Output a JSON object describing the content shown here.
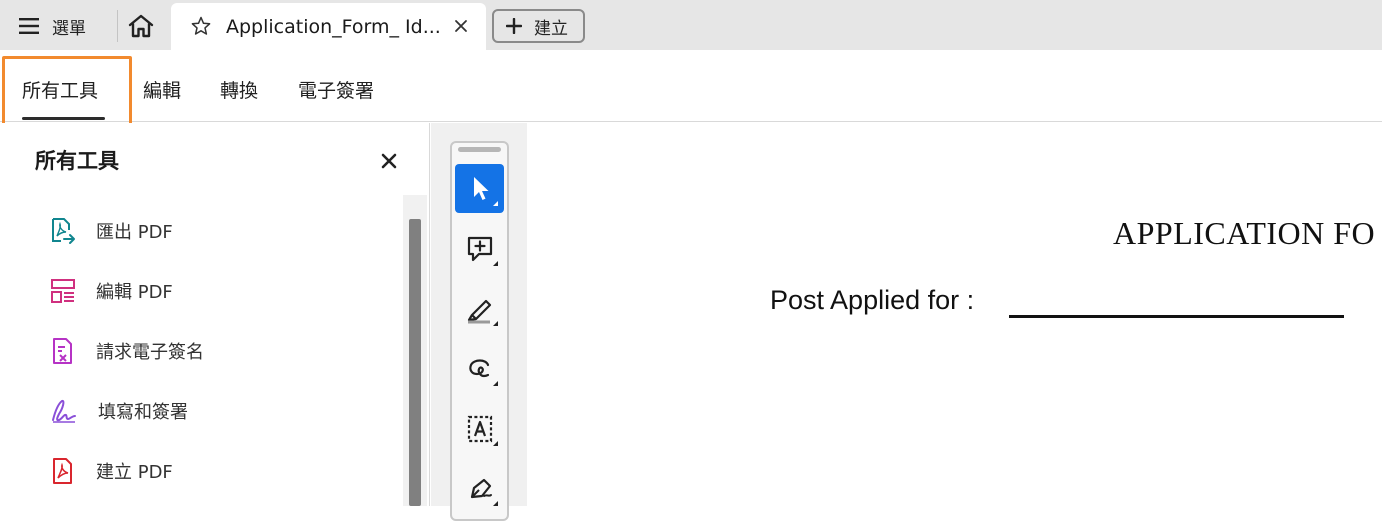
{
  "tabbar": {
    "menu_label": "選單",
    "document_tab_title": "Application_Form_ Id...",
    "create_label": "建立"
  },
  "toolbar_tabs": [
    {
      "label": "所有工具",
      "selected": true
    },
    {
      "label": "編輯",
      "selected": false
    },
    {
      "label": "轉換",
      "selected": false
    },
    {
      "label": "電子簽署",
      "selected": false
    }
  ],
  "panel": {
    "title": "所有工具",
    "items": [
      {
        "label": "匯出 PDF",
        "icon": "export-pdf-icon",
        "color": "#11868f"
      },
      {
        "label": "編輯 PDF",
        "icon": "edit-pdf-icon",
        "color": "#d0307f"
      },
      {
        "label": "請求電子簽名",
        "icon": "request-esign-icon",
        "color": "#b633c5"
      },
      {
        "label": "填寫和簽署",
        "icon": "fill-sign-icon",
        "color": "#8a4fd8"
      },
      {
        "label": "建立 PDF",
        "icon": "create-pdf-icon",
        "color": "#d9262e"
      }
    ]
  },
  "rail_tools": [
    {
      "icon": "select-cursor-icon",
      "active": true
    },
    {
      "icon": "add-comment-icon",
      "active": false
    },
    {
      "icon": "highlight-pen-icon",
      "active": false
    },
    {
      "icon": "freehand-draw-icon",
      "active": false
    },
    {
      "icon": "text-recognition-icon",
      "active": false
    },
    {
      "icon": "sign-pen-icon",
      "active": false
    }
  ],
  "document": {
    "heading": "APPLICATION FO",
    "post_applied_label": "Post Applied for  :"
  },
  "colors": {
    "accent_blue": "#1473e6",
    "focus_orange": "#f28a2e"
  }
}
